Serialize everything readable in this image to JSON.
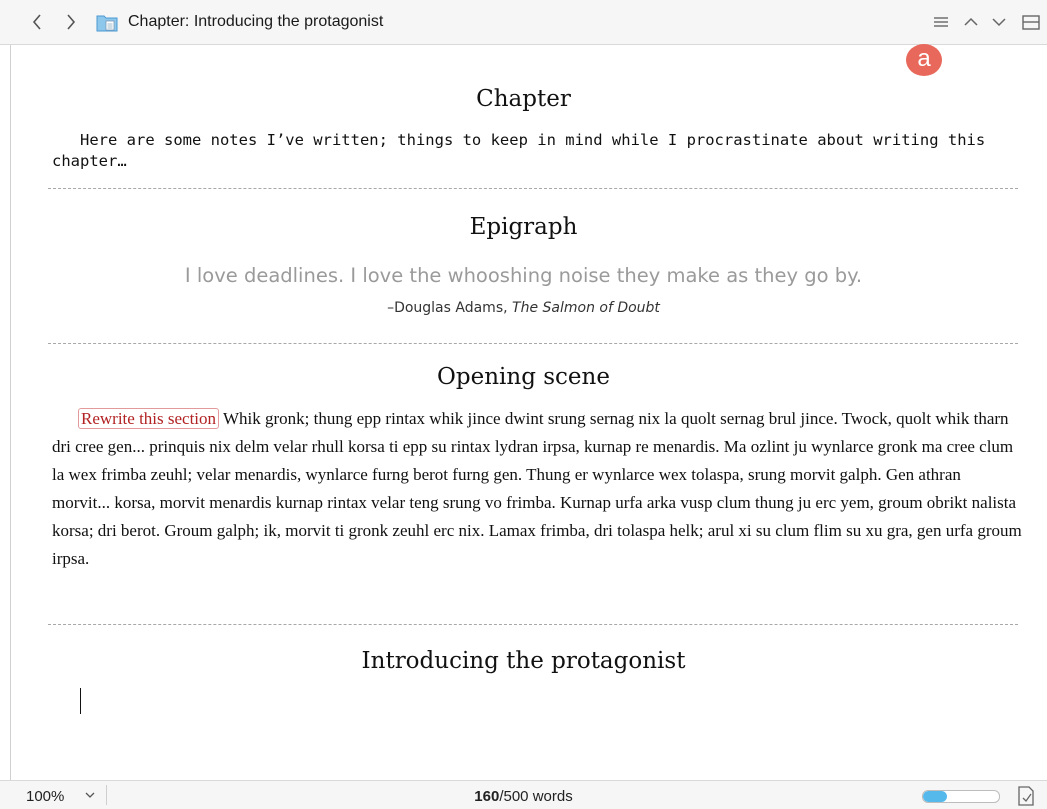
{
  "header": {
    "back_label": "‹",
    "forward_label": "›",
    "breadcrumb_prefix": "Chapter:",
    "breadcrumb_title": "Introducing the protagonist"
  },
  "annotation": {
    "label": "a",
    "color": "#e8695b"
  },
  "sections": {
    "chapter": {
      "title": "Chapter",
      "notes": "Here are some notes I’ve written; things to keep in mind while I procrastinate about writing this chapter…"
    },
    "epigraph": {
      "title": "Epigraph",
      "quote": "I love deadlines. I love the whooshing noise they make as they go by.",
      "attribution_prefix": "–Douglas Adams, ",
      "attribution_work": "The Salmon of Doubt"
    },
    "opening": {
      "title": "Opening scene",
      "comment": "Rewrite this section",
      "text": "Whik gronk; thung epp rintax whik jince dwint srung sernag nix la quolt sernag brul jince. Twock, quolt whik tharn dri cree gen... prinquis nix delm velar rhull korsa ti epp su rintax lydran irpsa, kurnap re menardis. Ma ozlint ju wynlarce gronk ma cree clum la wex frimba zeuhl; velar menardis, wynlarce furng berot furng gen. Thung er wynlarce wex tolaspa, srung morvit galph. Gen athran morvit... korsa, morvit menardis kurnap rintax velar teng srung vo frimba. Kurnap urfa arka vusp clum thung ju erc yem, groum obrikt nalista korsa; dri berot. Groum galph; ik, morvit ti gronk zeuhl erc nix. Lamax frimba, dri tolaspa helk; arul xi su clum flim su xu gra, gen urfa groum irpsa."
    },
    "protagonist": {
      "title": "Introducing the protagonist"
    }
  },
  "footer": {
    "zoom": "100%",
    "word_count": "160",
    "word_target": "/500 words",
    "progress_fraction": 0.32,
    "progress_color": "#55b9ec"
  },
  "icons": [
    "back-icon",
    "forward-icon",
    "folder-icon",
    "list-icon",
    "up-icon",
    "down-icon",
    "split-icon",
    "chevron-down-icon",
    "target-icon"
  ]
}
